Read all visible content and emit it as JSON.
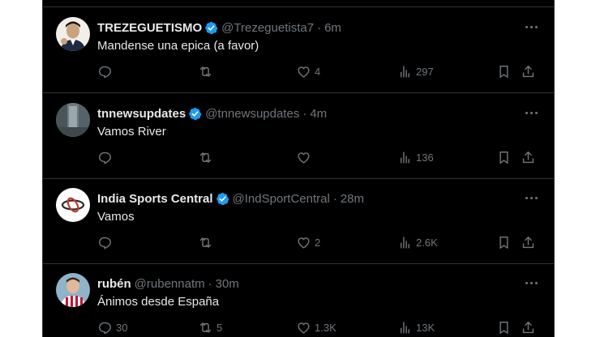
{
  "colors": {
    "background": "#000000",
    "text": "#e7e9ea",
    "muted": "#71767b",
    "verified": "#1d9bf0",
    "divider": "#2f3336"
  },
  "tweets": [
    {
      "name": "TREZEGUETISMO",
      "verified": true,
      "handle": "@Trezeguetista7",
      "sep": "·",
      "time": "6m",
      "text": "Mandense una epica (a favor)",
      "replies": "",
      "retweets": "",
      "likes": "4",
      "views": "297",
      "avatar_icon": "profile-photo"
    },
    {
      "name": "tnnewsupdates",
      "verified": true,
      "handle": "@tnnewsupdates",
      "sep": "·",
      "time": "4m",
      "text": "Vamos River",
      "replies": "",
      "retweets": "",
      "likes": "",
      "views": "136",
      "avatar_icon": "profile-photo"
    },
    {
      "name": "India Sports Central",
      "verified": true,
      "handle": "@IndSportCentral",
      "sep": "·",
      "time": "28m",
      "text": "Vamos",
      "replies": "",
      "retweets": "",
      "likes": "2",
      "views": "2.6K",
      "avatar_icon": "logo"
    },
    {
      "name": "rubén",
      "verified": false,
      "handle": "@rubennatm",
      "sep": "·",
      "time": "30m",
      "text": "Ánimos desde España",
      "replies": "30",
      "retweets": "5",
      "likes": "1.3K",
      "views": "13K",
      "avatar_icon": "profile-photo"
    }
  ]
}
